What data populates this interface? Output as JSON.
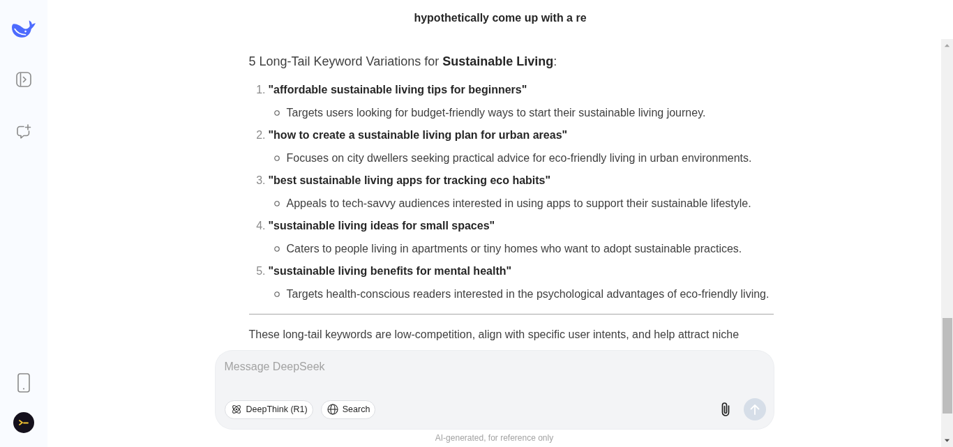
{
  "header": {
    "chat_title": "hypothetically come up with a re"
  },
  "answer": {
    "heading": "5 Long-Tail Keyword Variations for **Sustainable Living**:",
    "items": [
      {
        "number": "1.",
        "keyword": "\"affordable sustainable living tips for beginners\"",
        "details": [
          "Targets users looking for budget-friendly ways to start their sustainable living journey."
        ]
      },
      {
        "number": "2.",
        "keyword": "\"how to create a sustainable living plan for urban areas\"",
        "details": [
          "Focuses on city dwellers seeking practical advice for eco-friendly living in urban environments."
        ]
      },
      {
        "number": "3.",
        "keyword": "\"best sustainable living apps for tracking eco habits\"",
        "details": [
          "Appeals to tech-savvy audiences interested in using apps to support their sustainable lifestyle."
        ]
      },
      {
        "number": "4.",
        "keyword": "\"sustainable living ideas for small spaces\"",
        "details": [
          "Caters to people living in apartments or tiny homes who want to adopt sustainable practices."
        ]
      },
      {
        "number": "5.",
        "keyword": "\"sustainable living benefits for mental health\"",
        "details": [
          "Targets health-conscious readers interested in the psychological advantages of eco-friendly living."
        ]
      }
    ],
    "paragraph": "These long-tail keywords are low-competition, align with specific user intents, and help attract niche"
  },
  "composer": {
    "placeholder": "Message DeepSeek",
    "toggles": [
      {
        "kind": "deepthink",
        "label": "DeepThink (R1)",
        "selected": false
      },
      {
        "kind": "search",
        "label": "Search",
        "selected": false
      }
    ],
    "send": {
      "disabled": true
    }
  },
  "footer_note": "AI-generated, for reference only"
}
